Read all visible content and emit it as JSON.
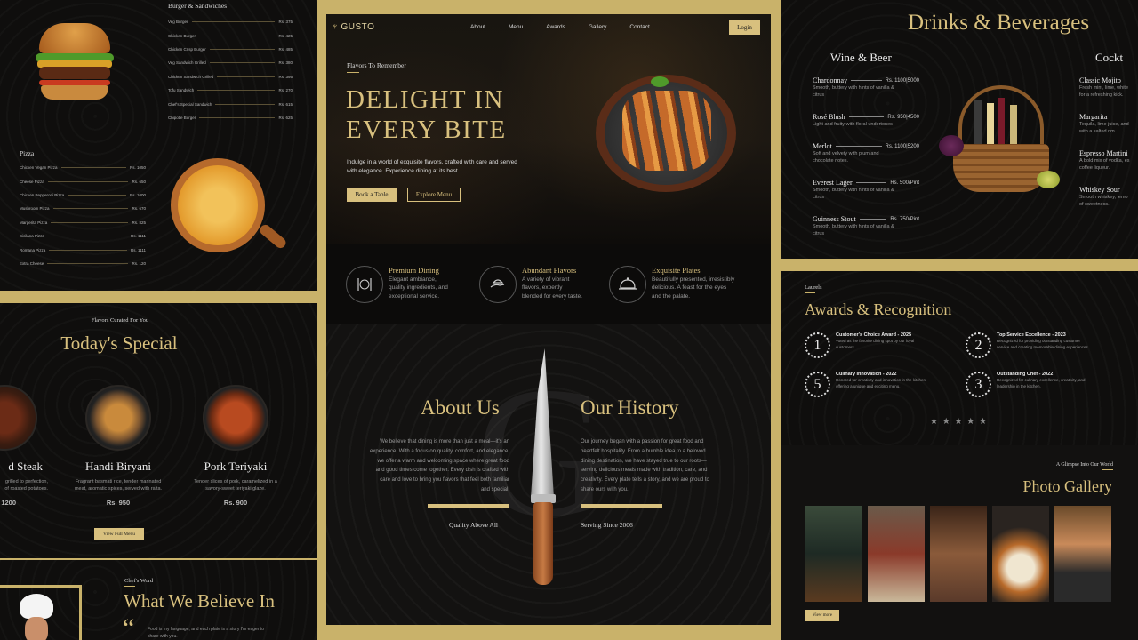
{
  "menu_panel": {
    "burger_title": "Burger & Sandwiches",
    "burger_items": [
      {
        "name": "Veg Burger",
        "price": "Rs. 375"
      },
      {
        "name": "Chicken Burger",
        "price": "Rs. 425"
      },
      {
        "name": "Chicken Crisp Burger",
        "price": "Rs. 485"
      },
      {
        "name": "Veg Sandwich Grilled",
        "price": "Rs. 380"
      },
      {
        "name": "Chicken Sandwich Grilled",
        "price": "Rs. 395"
      },
      {
        "name": "Tofu Sandwich",
        "price": "Rs. 270"
      },
      {
        "name": "Chef's Special Sandwich",
        "price": "Rs. 615"
      },
      {
        "name": "Chipotle Burger",
        "price": "Rs. 625"
      }
    ],
    "pizza_title": "Pizza",
    "pizza_items": [
      {
        "name": "Chicken Vegan Pizza",
        "price": "Rs. 1050"
      },
      {
        "name": "Cheese Pizza",
        "price": "Rs. 650"
      },
      {
        "name": "Chicken Pepperoni Pizza",
        "price": "Rs. 1000"
      },
      {
        "name": "Mushroom Pizza",
        "price": "Rs. 670"
      },
      {
        "name": "Margerita Pizza",
        "price": "Rs. 825"
      },
      {
        "name": "Sicilana Pizza",
        "price": "Rs. 1111"
      },
      {
        "name": "Romana Pizza",
        "price": "Rs. 1111"
      },
      {
        "name": "Extra Cheese",
        "price": "Rs. 120"
      }
    ]
  },
  "special": {
    "eyebrow": "Flavors Curated For You",
    "title": "Today's Special",
    "dishes": [
      {
        "name": "d Steak",
        "desc": "grilled to perfection,\nof roasted potatoes.",
        "price": "1200"
      },
      {
        "name": "Handi Biryani",
        "desc": "Fragrant basmati rice, tender marinated\nmeat, aromatic spices, served with raita.",
        "price": "Rs. 950"
      },
      {
        "name": "Pork Teriyaki",
        "desc": "Tender slices of pork, caramelized in a\nsavory-sweet teriyaki glaze.",
        "price": "Rs. 900"
      }
    ],
    "button": "View Full Menu"
  },
  "believe": {
    "eyebrow": "Chef's Word",
    "title": "What We Believe In",
    "quote": "Food is my language, and each plate is a story I'm eager to\nshare with you."
  },
  "center": {
    "brand": "GUSTO",
    "nav": [
      "About",
      "Menu",
      "Awards",
      "Gallery",
      "Contact"
    ],
    "login": "Login",
    "hero_eyebrow": "Flavors To Remember",
    "hero_line1": "DELIGHT IN",
    "hero_line2": "EVERY BITE",
    "hero_text": "Indulge in a world of exquisite flavors, crafted with care and served\nwith elegance. Experience dining at its best.",
    "btn_book": "Book a Table",
    "btn_explore": "Explore Menu",
    "features": [
      {
        "title": "Premium Dining",
        "text": "Elegant ambiance,\nquality ingredients, and\nexceptional service.",
        "icon": "fork-knife-icon"
      },
      {
        "title": "Abundant Flavors",
        "text": "A variety of vibrant\nflavors, expertly\nblended for every taste.",
        "icon": "serving-hand-icon"
      },
      {
        "title": "Exquisite Plates",
        "text": "Beautifully presented, irresistibly\ndelicious. A feast for the eyes\nand the palate.",
        "icon": "cloche-icon"
      }
    ],
    "about_title": "About Us",
    "about_text": "We believe that dining is more than just a meal—it's an\nexperience. With a focus on quality, comfort, and elegance,\nwe offer a warm and welcoming space where great food\nand good times come together. Every dish is crafted with\ncare and love to bring you flavors that feel both familiar\nand special.",
    "about_tag": "Quality Above All",
    "history_title": "Our History",
    "history_text": "Our journey began with a passion for great food and\nheartfelt hospitality. From a humble idea to a beloved\ndining destination, we have stayed true to our roots—\nserving delicious meals made with tradition, care, and\ncreativity. Every plate tells a story, and we are proud to\nshare ours with you.",
    "history_tag": "Serving Since 2006"
  },
  "drinks": {
    "title": "Drinks & Beverages",
    "wine_title": "Wine & Beer",
    "cocktail_title": "Cockt",
    "wine_items": [
      {
        "name": "Chardonnay",
        "price": "Rs. 1100|5000",
        "desc": "Smooth, buttery with hints of vanilla &\ncitrus"
      },
      {
        "name": "Rosé Blush",
        "price": "Rs. 950|4500",
        "desc": "Light and fruity with floral undertones"
      },
      {
        "name": "Merlot",
        "price": "Rs. 1100|5200",
        "desc": "Soft and velvety with plum and\nchocolate notes."
      },
      {
        "name": "Everest Lager",
        "price": "Rs. 500/Pint",
        "desc": "Smooth, buttery with hints of vanilla &\ncitrus"
      },
      {
        "name": "Guinness Stout",
        "price": "Rs. 750/Pint",
        "desc": "Smooth, buttery with hints of vanilla &\ncitrus"
      }
    ],
    "cocktail_items": [
      {
        "name": "Classic Mojito",
        "desc": "Fresh mint, lime, white\nfor a refreshing kick."
      },
      {
        "name": "Margarita",
        "desc": "Tequila, lime juice, and\nwith a salted rim."
      },
      {
        "name": "Espresso Martini",
        "desc": "A bold mix of vodka, es\ncoffee liqueur."
      },
      {
        "name": "Whiskey Sour",
        "desc": "Smooth whiskey, lemo\nof sweetness."
      }
    ]
  },
  "awards": {
    "eyebrow": "Laurels",
    "title": "Awards & Recognition",
    "items": [
      {
        "num": "1",
        "title": "Customer's Choice Award - 2025",
        "text": "Voted as the favorite dining spot by our loyal\ncustomers."
      },
      {
        "num": "2",
        "title": "Top Service Excellence - 2023",
        "text": "Recognized for providing outstanding customer\nservice and creating memorable dining experiences."
      },
      {
        "num": "5",
        "title": "Culinary Innovation - 2022",
        "text": "Honored for creativity and innovation in the kitchen,\noffering a unique and exciting menu."
      },
      {
        "num": "3",
        "title": "Outstanding Chef - 2022",
        "text": "Recognized for culinary excellence, creativity, and\nleadership in the kitchen."
      }
    ],
    "stars": "★ ★ ★ ★ ★",
    "gallery_eyebrow": "A Glimpse Into Our World",
    "gallery_title": "Photo Gallery",
    "gallery_button": "View more"
  }
}
